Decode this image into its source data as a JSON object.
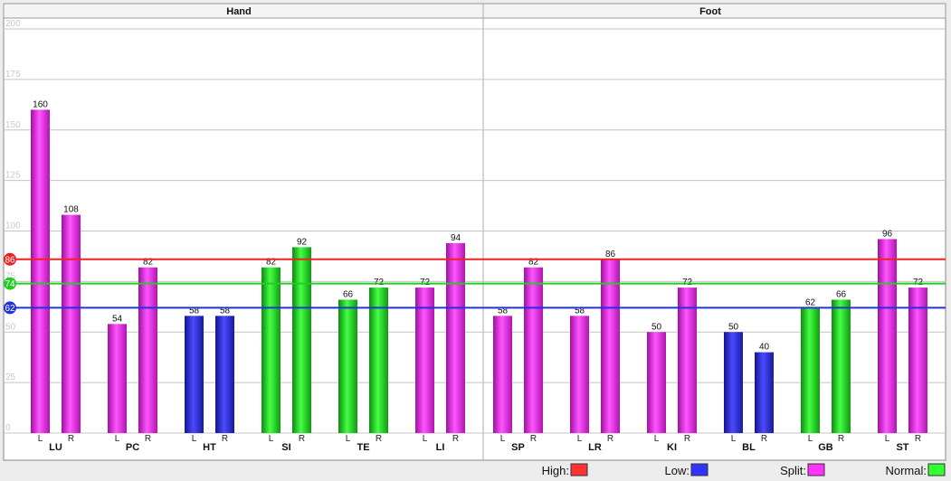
{
  "chart_data": {
    "type": "bar",
    "panels": [
      {
        "title": "Hand",
        "groups": [
          {
            "name": "LU",
            "L": 160,
            "R": 108,
            "L_status": "Split",
            "R_status": "Split"
          },
          {
            "name": "PC",
            "L": 54,
            "R": 82,
            "L_status": "Split",
            "R_status": "Split"
          },
          {
            "name": "HT",
            "L": 58,
            "R": 58,
            "L_status": "Low",
            "R_status": "Low"
          },
          {
            "name": "SI",
            "L": 82,
            "R": 92,
            "L_status": "Normal",
            "R_status": "Normal"
          },
          {
            "name": "TE",
            "L": 66,
            "R": 72,
            "L_status": "Normal",
            "R_status": "Normal"
          },
          {
            "name": "LI",
            "L": 72,
            "R": 94,
            "L_status": "Split",
            "R_status": "Split"
          }
        ]
      },
      {
        "title": "Foot",
        "groups": [
          {
            "name": "SP",
            "L": 58,
            "R": 82,
            "L_status": "Split",
            "R_status": "Split"
          },
          {
            "name": "LR",
            "L": 58,
            "R": 86,
            "L_status": "Split",
            "R_status": "Split"
          },
          {
            "name": "KI",
            "L": 50,
            "R": 72,
            "L_status": "Split",
            "R_status": "Split"
          },
          {
            "name": "BL",
            "L": 50,
            "R": 40,
            "L_status": "Low",
            "R_status": "Low"
          },
          {
            "name": "GB",
            "L": 62,
            "R": 66,
            "L_status": "Normal",
            "R_status": "Normal"
          },
          {
            "name": "ST",
            "L": 96,
            "R": 72,
            "L_status": "Split",
            "R_status": "Split"
          }
        ]
      }
    ],
    "side_labels": {
      "left": "L",
      "right": "R"
    },
    "y_ticks": [
      0,
      25,
      50,
      75,
      100,
      125,
      150,
      175,
      200
    ],
    "ylim": [
      0,
      200
    ],
    "grid": true,
    "reference_lines": [
      {
        "label": "86",
        "value": 86,
        "color": "#ee2222"
      },
      {
        "label": "74",
        "value": 74,
        "color": "#22cc22"
      },
      {
        "label": "62",
        "value": 62,
        "color": "#2233dd"
      }
    ],
    "legend_position": "bottom-right",
    "legend": [
      {
        "label": "High:",
        "color": "#ff3333"
      },
      {
        "label": "Low:",
        "color": "#3333ff"
      },
      {
        "label": "Split:",
        "color": "#ff33ff"
      },
      {
        "label": "Normal:",
        "color": "#33ff33"
      }
    ],
    "status_colors": {
      "High": "#e62020",
      "Low": "#2a2ad8",
      "Split": "#e020e0",
      "Normal": "#22cc22"
    }
  }
}
